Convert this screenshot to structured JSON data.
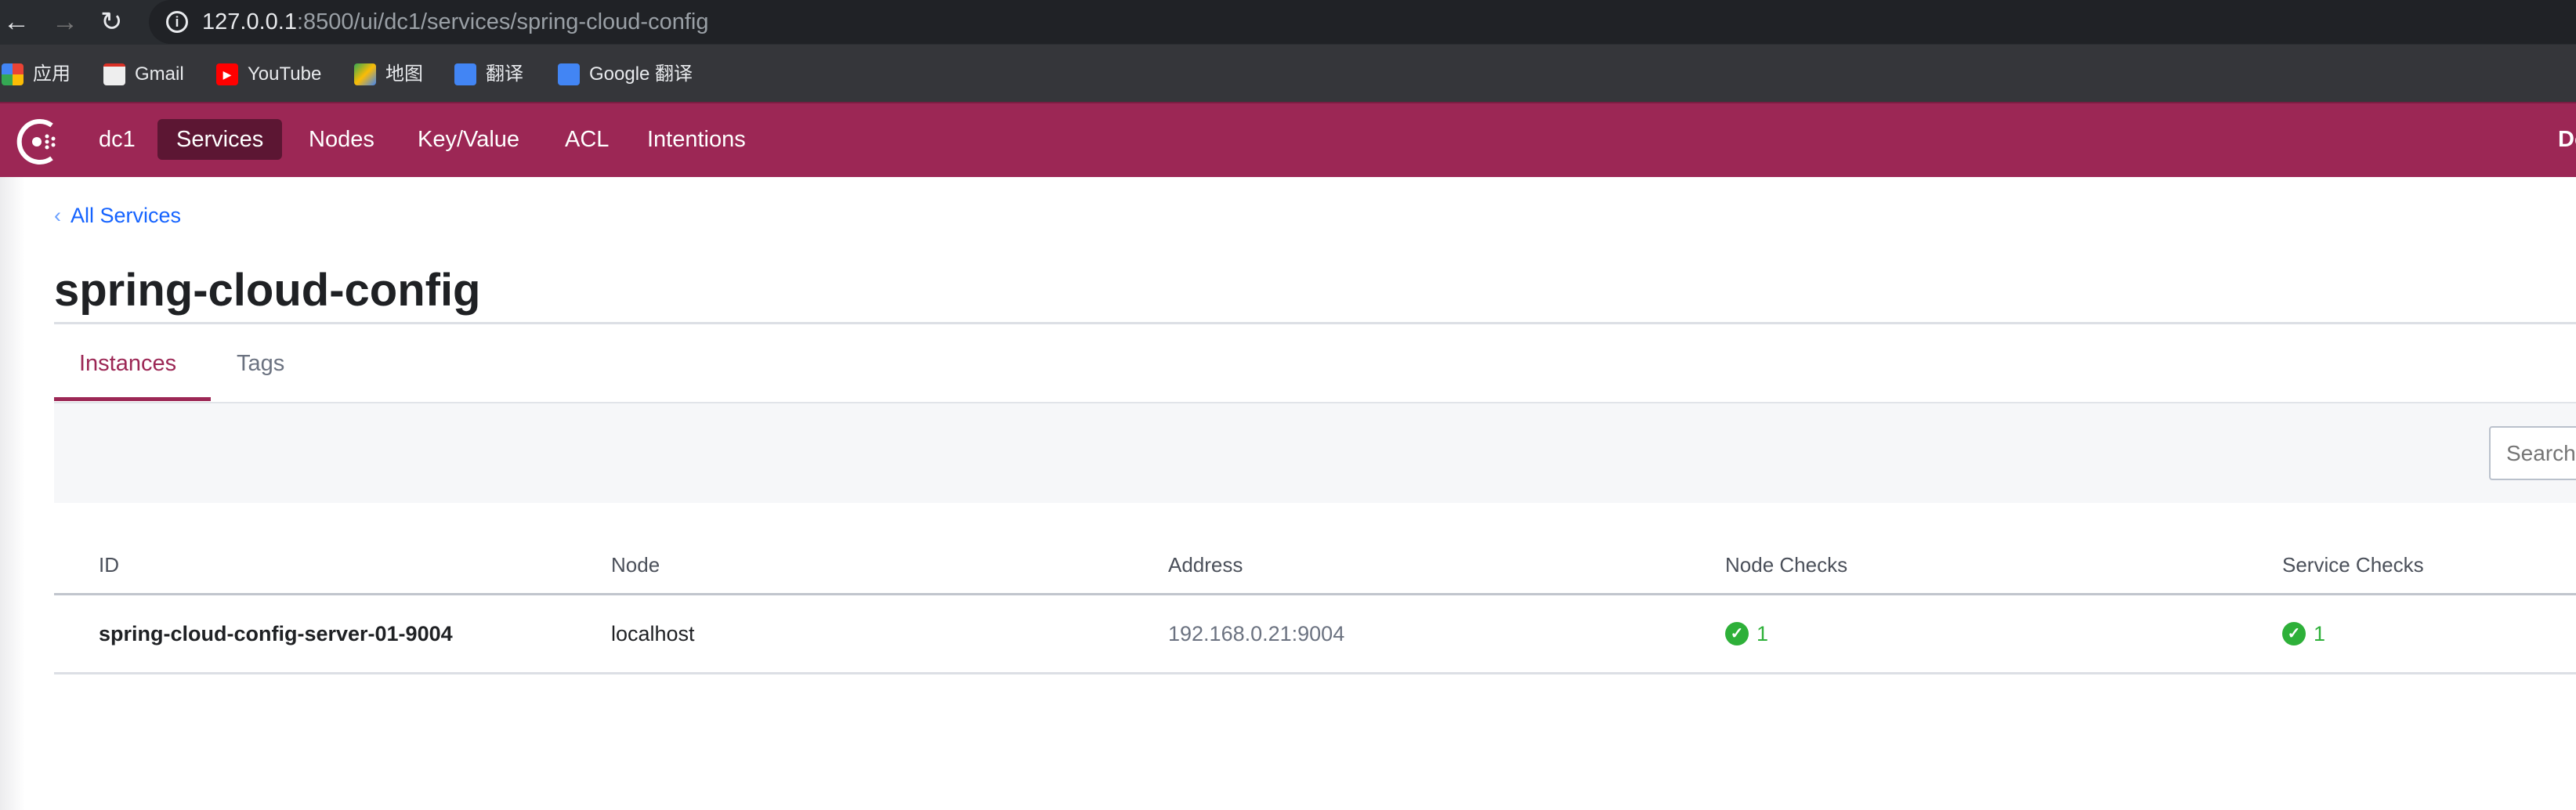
{
  "browser": {
    "url_host": "127.0.0.1",
    "url_rest": ":8500/ui/dc1/services/spring-cloud-config",
    "bookmarks": [
      {
        "label": "应用",
        "icon": "apps-grid-icon"
      },
      {
        "label": "Gmail",
        "icon": "gmail-icon"
      },
      {
        "label": "YouTube",
        "icon": "youtube-icon"
      },
      {
        "label": "地图",
        "icon": "maps-icon"
      },
      {
        "label": "翻译",
        "icon": "translate-icon"
      },
      {
        "label": "Google 翻译",
        "icon": "translate-icon"
      }
    ]
  },
  "header": {
    "datacenter": "dc1",
    "nav": [
      "Services",
      "Nodes",
      "Key/Value",
      "ACL",
      "Intentions"
    ],
    "active": "Services",
    "right_partial": "Do",
    "brand_color": "#9c2755"
  },
  "page": {
    "breadcrumb": "All Services",
    "title": "spring-cloud-config",
    "tabs": [
      "Instances",
      "Tags"
    ],
    "active_tab": "Instances",
    "search_placeholder": "Search"
  },
  "table": {
    "columns": [
      "ID",
      "Node",
      "Address",
      "Node Checks",
      "Service Checks"
    ],
    "rows": [
      {
        "id": "spring-cloud-config-server-01-9004",
        "node": "localhost",
        "address": "192.168.0.21:9004",
        "node_checks": "1",
        "service_checks": "1"
      }
    ]
  },
  "colors": {
    "passing": "#2eb039",
    "link": "#1563ff"
  }
}
